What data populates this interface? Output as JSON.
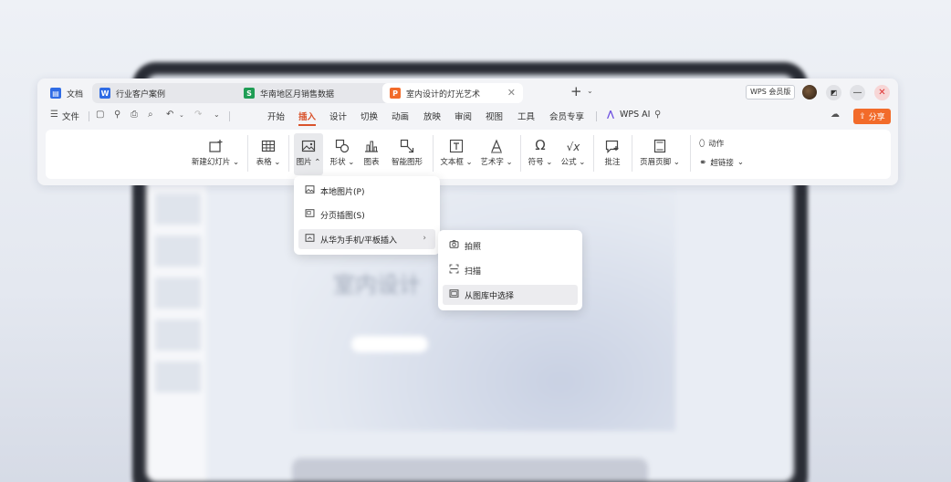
{
  "background": {
    "slide_title": "室内设计"
  },
  "tabs": [
    {
      "label": "文档",
      "badge": "",
      "color": "#2f6ce5"
    },
    {
      "label": "行业客户案例",
      "badge": "W",
      "color": "#2f6ce5"
    },
    {
      "label": "华南地区月销售数据",
      "badge": "S",
      "color": "#1f9d55"
    },
    {
      "label": "室内设计的灯光艺术",
      "badge": "P",
      "color": "#f26b2a"
    }
  ],
  "titlebar": {
    "version_badge": "WPS 会员版"
  },
  "menubar": {
    "file_label": "文件",
    "items": [
      "开始",
      "插入",
      "设计",
      "切换",
      "动画",
      "放映",
      "审阅",
      "视图",
      "工具",
      "会员专享"
    ],
    "active": "插入",
    "ai_label": "WPS AI",
    "share_label": "分享",
    "accent": "#d9532c"
  },
  "ribbon": {
    "new_slide": "新建幻灯片",
    "table": "表格",
    "picture": "图片",
    "shape": "形状",
    "chart": "图表",
    "smart_graphic": "智能图形",
    "textbox": "文本框",
    "wordart": "艺术字",
    "symbol": "符号",
    "formula": "公式",
    "comment": "批注",
    "header_footer": "页眉页脚",
    "action": "动作",
    "hyperlink": "超链接"
  },
  "picture_menu": {
    "items": [
      "本地图片(P)",
      "分页插图(S)",
      "从华为手机/平板插入"
    ]
  },
  "device_menu": {
    "items": [
      "拍照",
      "扫描",
      "从图库中选择"
    ]
  }
}
